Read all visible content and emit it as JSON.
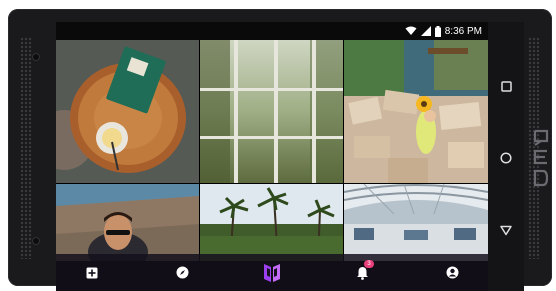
{
  "status_bar": {
    "time": "8:36 PM",
    "icons": [
      "wifi-icon",
      "cell-signal-icon",
      "battery-icon"
    ]
  },
  "photo_grid": {
    "tiles": [
      {
        "name": "notebook-on-wood-slice-photo"
      },
      {
        "name": "misty-window-greenery-photo"
      },
      {
        "name": "woman-with-sunflower-photo"
      },
      {
        "name": "man-with-sunglasses-photo"
      },
      {
        "name": "palm-trees-photo"
      },
      {
        "name": "airport-terminal-photo"
      }
    ]
  },
  "bottom_nav": {
    "items": [
      {
        "name": "add-icon"
      },
      {
        "name": "compass-icon"
      },
      {
        "name": "app-logo-icon"
      },
      {
        "name": "notifications-icon",
        "badge": "3"
      },
      {
        "name": "profile-icon"
      }
    ]
  },
  "system_nav": {
    "items": [
      "recent-apps-icon",
      "home-icon",
      "back-icon"
    ]
  },
  "device": {
    "brand_logo": "RED"
  },
  "colors": {
    "accent": "#b04cf0",
    "badge": "#e8407a",
    "nav_bg": "#14101c",
    "phone_body": "#1a1a1c"
  }
}
